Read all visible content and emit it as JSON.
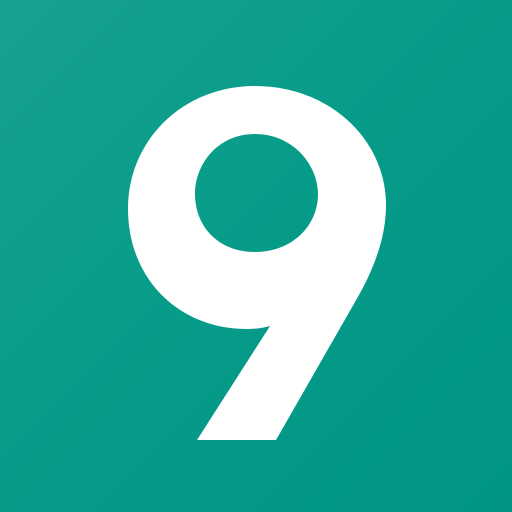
{
  "icon": {
    "glyph_name": "number-nine-icon",
    "digit": "9",
    "background_color_start": "#17a28f",
    "background_color_end": "#009584",
    "foreground_color": "#ffffff"
  }
}
